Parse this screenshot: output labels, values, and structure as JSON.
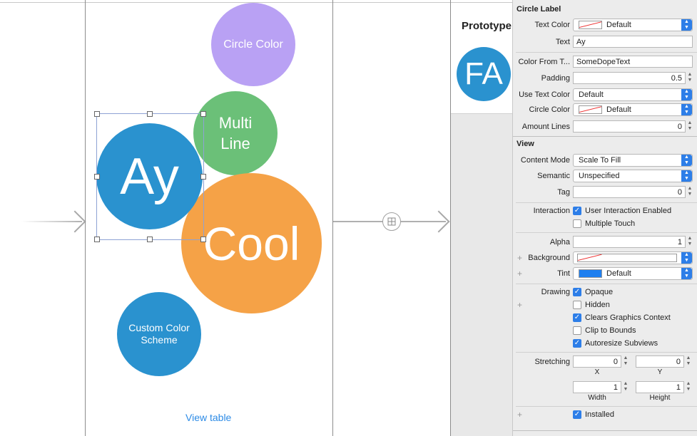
{
  "canvas": {
    "circles": {
      "circle_color": "Circle Color",
      "multi_line_1": "Multi",
      "multi_line_2": "Line",
      "ay": "Ay",
      "cool": "Cool",
      "custom_1": "Custom Color",
      "custom_2": "Scheme"
    },
    "view_table_link": "View table",
    "prototype_title": "Prototype",
    "prototype_avatar": "FA"
  },
  "colors": {
    "purple": "#b9a1f4",
    "green": "#6bc078",
    "blue": "#2a92cf",
    "orange": "#f5a247",
    "link": "#2d8be6",
    "accent": "#2d7ee8"
  },
  "inspector": {
    "circle_label": {
      "title": "Circle Label",
      "text_color_label": "Text Color",
      "text_color_value": "Default",
      "text_label": "Text",
      "text_value": "Ay",
      "color_from_text_label": "Color From T...",
      "color_from_text_value": "SomeDopeText",
      "padding_label": "Padding",
      "padding_value": "0.5",
      "use_text_color_label": "Use Text Color",
      "use_text_color_value": "Default",
      "circle_color_label": "Circle Color",
      "circle_color_value": "Default",
      "amount_lines_label": "Amount Lines",
      "amount_lines_value": "0"
    },
    "view": {
      "title": "View",
      "content_mode_label": "Content Mode",
      "content_mode_value": "Scale To Fill",
      "semantic_label": "Semantic",
      "semantic_value": "Unspecified",
      "tag_label": "Tag",
      "tag_value": "0",
      "interaction_label": "Interaction",
      "user_interaction": "User Interaction Enabled",
      "multiple_touch": "Multiple Touch",
      "alpha_label": "Alpha",
      "alpha_value": "1",
      "background_label": "Background",
      "tint_label": "Tint",
      "tint_value": "Default",
      "drawing_label": "Drawing",
      "opaque": "Opaque",
      "hidden": "Hidden",
      "clears_graphics": "Clears Graphics Context",
      "clip_to_bounds": "Clip to Bounds",
      "autoresize": "Autoresize Subviews",
      "stretching_label": "Stretching",
      "stretch_x": "0",
      "stretch_y": "0",
      "x_cap": "X",
      "y_cap": "Y",
      "stretch_width": "1",
      "stretch_height": "1",
      "width_cap": "Width",
      "height_cap": "Height",
      "installed": "Installed"
    },
    "checks": {
      "user_interaction": true,
      "multiple_touch": false,
      "opaque": true,
      "hidden": false,
      "clears_graphics": true,
      "clip_to_bounds": false,
      "autoresize": true,
      "installed": true
    }
  }
}
